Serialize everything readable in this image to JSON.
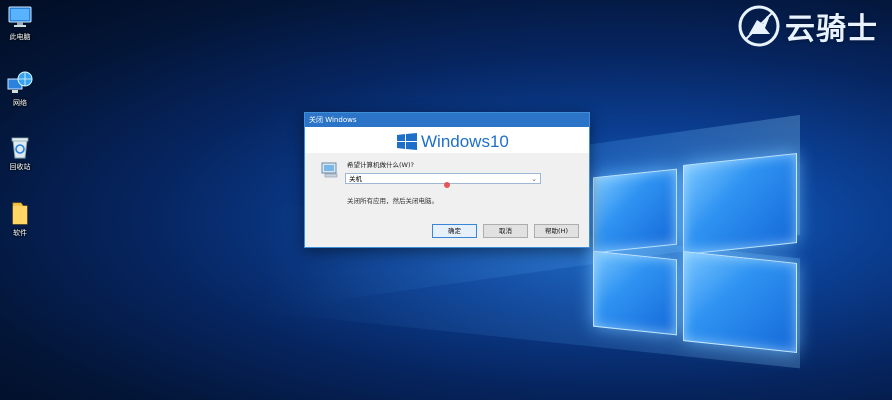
{
  "desktop": {
    "icons": [
      {
        "label": "此电脑",
        "icon": "computer-icon"
      },
      {
        "label": "网络",
        "icon": "network-icon"
      },
      {
        "label": "回收站",
        "icon": "recycle-bin-icon"
      },
      {
        "label": "软件",
        "icon": "folder-icon"
      }
    ]
  },
  "brand": {
    "text": "云骑士",
    "icon": "knight-logo-icon",
    "color": "#e8f3ff"
  },
  "dialog": {
    "title": "关闭 Windows",
    "banner_text": "Windows10",
    "prompt": "希望计算机做什么(W)?",
    "selected_option": "关机",
    "description": "关闭所有应用，然后关闭电脑。",
    "buttons": {
      "ok": "确定",
      "cancel": "取消",
      "help": "帮助(H)"
    },
    "accent": "#2b74c8"
  }
}
